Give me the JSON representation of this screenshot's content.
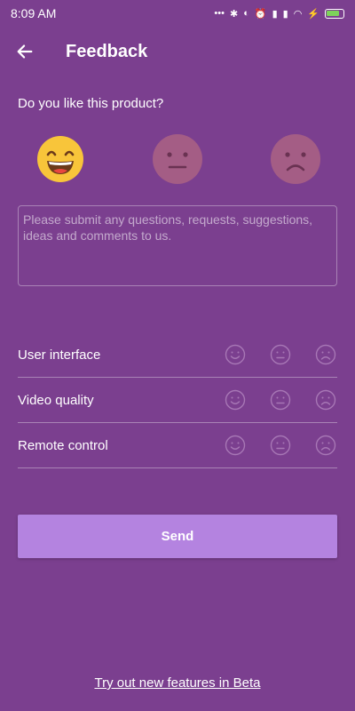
{
  "status_bar": {
    "time": "8:09 AM",
    "icons": [
      "dots-icon",
      "bluetooth-icon",
      "toggle-icon",
      "alarm-icon",
      "signal-icon",
      "signal-icon",
      "wifi-icon",
      "charging-icon",
      "battery-icon"
    ]
  },
  "header": {
    "title": "Feedback",
    "back_icon": "arrow-left-icon"
  },
  "main": {
    "question": "Do you like this product?",
    "faces": [
      {
        "name": "happy",
        "selected": true
      },
      {
        "name": "neutral",
        "selected": false
      },
      {
        "name": "sad",
        "selected": false
      }
    ],
    "comment_placeholder": "Please submit any questions, requests, suggestions, ideas and comments to us.",
    "ratings": [
      {
        "label": "User interface"
      },
      {
        "label": "Video quality"
      },
      {
        "label": "Remote control"
      }
    ],
    "send_label": "Send",
    "beta_link": "Try out new features in Beta"
  },
  "colors": {
    "background": "#7b3f8f",
    "button": "#b483e0",
    "happy_face": "#f8c53a",
    "inactive_face": "#a45d85"
  }
}
